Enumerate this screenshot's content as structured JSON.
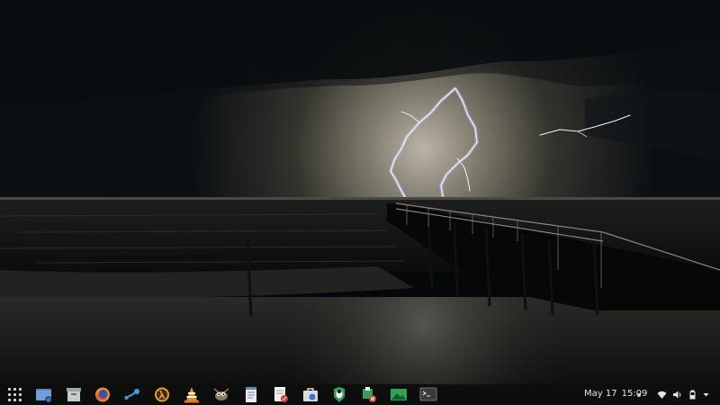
{
  "desktop": {
    "wallpaper": "lightning-over-pier-at-night"
  },
  "taskbar": {
    "app_grid_icon": "app-grid-icon",
    "launchers": [
      {
        "name": "file-manager-launcher",
        "icon": "folder-icon"
      },
      {
        "name": "archive-manager-launcher",
        "icon": "archive-icon"
      },
      {
        "name": "firefox-launcher",
        "icon": "firefox-icon"
      },
      {
        "name": "steam-launcher",
        "icon": "steam-icon"
      },
      {
        "name": "half-life-launcher",
        "icon": "lambda-icon"
      },
      {
        "name": "vlc-launcher",
        "icon": "vlc-cone-icon"
      },
      {
        "name": "gimp-launcher",
        "icon": "gimp-icon"
      },
      {
        "name": "text-document-launcher",
        "icon": "document-icon"
      },
      {
        "name": "document-viewer-launcher",
        "icon": "document-viewer-icon"
      },
      {
        "name": "software-store-launcher",
        "icon": "shopping-bag-icon"
      },
      {
        "name": "mechanic-launcher",
        "icon": "tux-icon"
      },
      {
        "name": "package-installer-launcher",
        "icon": "package-icon"
      },
      {
        "name": "image-viewer-launcher",
        "icon": "image-viewer-icon"
      },
      {
        "name": "terminal-launcher",
        "icon": "terminal-icon"
      }
    ],
    "clock": {
      "date": "May 17",
      "time": "15:09"
    },
    "tray": {
      "icons": [
        "wifi-icon",
        "volume-icon",
        "battery-icon",
        "chevron-down-icon"
      ]
    }
  }
}
